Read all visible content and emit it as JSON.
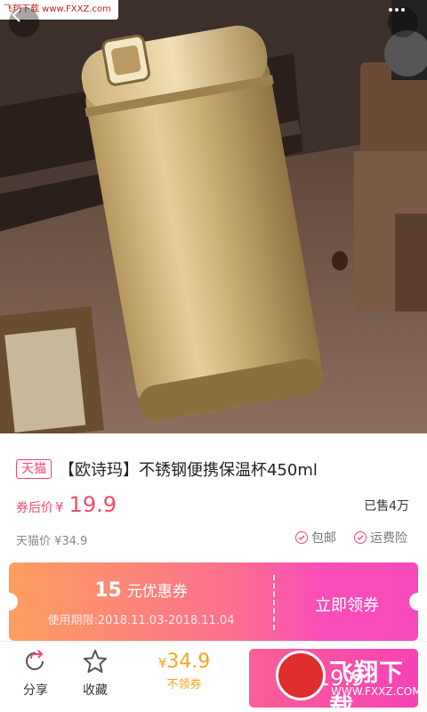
{
  "watermark": {
    "top": "飞翔下载 www.FXXZ.com",
    "brand": "飞翔下载",
    "url": "WWW.FXXZ.COM"
  },
  "hero": {
    "back_icon": "chevron-left-icon",
    "more_icon": "more-dots-icon"
  },
  "product": {
    "platform_tag": "天猫",
    "title": "【欧诗玛】不锈钢便携保温杯450ml",
    "price_label": "券后价",
    "currency": "¥",
    "coupon_price": "19.9",
    "sold": "已售4万",
    "original_price": "天猫价 ¥34.9",
    "services": [
      "包邮",
      "运费险"
    ]
  },
  "coupon": {
    "amount": "15",
    "amount_text": "元优惠券",
    "period": "使用期限:2018.11.03-2018.11.04",
    "claim_label": "立即领券"
  },
  "bottom_bar": {
    "share_label": "分享",
    "favorite_label": "收藏",
    "price_currency": "¥",
    "price_value": "34.9",
    "no_coupon_label": "不领券",
    "buy_label": "¥19.9"
  },
  "colors": {
    "accent": "#f24b6a",
    "coupon_start": "#fd9f5f",
    "coupon_end": "#f74aba",
    "orange": "#f7a623"
  }
}
